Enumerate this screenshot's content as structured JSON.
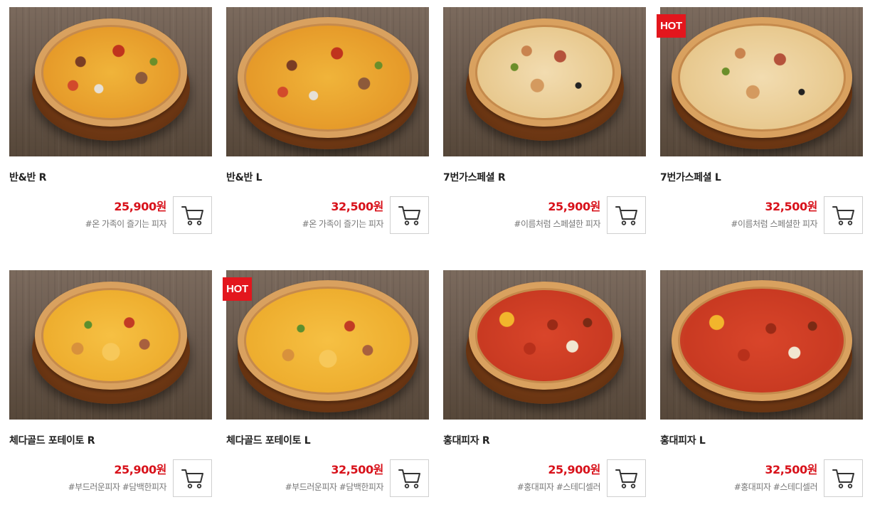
{
  "products": [
    {
      "name": "반&반 R",
      "price": "25,900원",
      "tags": "#온 가족이 즐기는 피자",
      "hot": false,
      "variant": "mix",
      "size": "r",
      "cart_icon": "cart-icon"
    },
    {
      "name": "반&반 L",
      "price": "32,500원",
      "tags": "#온 가족이 즐기는 피자",
      "hot": false,
      "variant": "mix",
      "size": "l",
      "cart_icon": "cart-icon"
    },
    {
      "name": "7번가스페셜 R",
      "price": "25,900원",
      "tags": "#이름처럼 스페셜한 피자",
      "hot": false,
      "variant": "special",
      "size": "r",
      "cart_icon": "cart-icon"
    },
    {
      "name": "7번가스페셜 L",
      "price": "32,500원",
      "tags": "#이름처럼 스페셜한 피자",
      "hot": true,
      "variant": "special",
      "size": "l",
      "cart_icon": "cart-icon"
    },
    {
      "name": "체다골드 포테이토 R",
      "price": "25,900원",
      "tags": "#부드러운피자 #담백한피자",
      "hot": false,
      "variant": "cheddar",
      "size": "r",
      "cart_icon": "cart-icon"
    },
    {
      "name": "체다골드 포테이토 L",
      "price": "32,500원",
      "tags": "#부드러운피자 #담백한피자",
      "hot": true,
      "variant": "cheddar",
      "size": "l",
      "cart_icon": "cart-icon"
    },
    {
      "name": "홍대피자 R",
      "price": "25,900원",
      "tags": "#홍대피자 #스테디셀러",
      "hot": false,
      "variant": "hongdae",
      "size": "r",
      "cart_icon": "cart-icon"
    },
    {
      "name": "홍대피자 L",
      "price": "32,500원",
      "tags": "#홍대피자 #스테디셀러",
      "hot": false,
      "variant": "hongdae",
      "size": "l",
      "cart_icon": "cart-icon"
    }
  ],
  "badge": {
    "hot_label": "HOT"
  },
  "colors": {
    "price": "#d8121b",
    "hot_badge": "#e3161d",
    "tag_text": "#777777",
    "cart_border": "#cfcfcf"
  }
}
